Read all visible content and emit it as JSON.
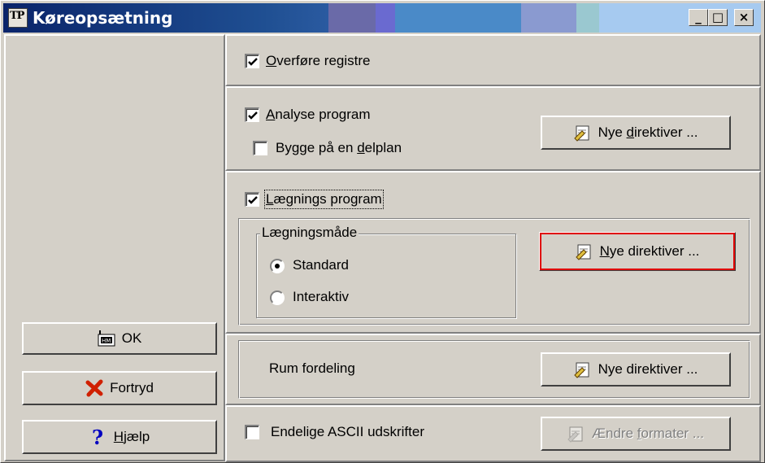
{
  "window": {
    "title": "Køreopsætning",
    "app_icon_text": "TP",
    "minimize": "_",
    "maximize": "□",
    "close": "×"
  },
  "colors": {
    "title_gradient": [
      "#0a246a",
      "#2a5aa0",
      "#6a6aa8",
      "#6a6ad0",
      "#4a8ac8",
      "#8a9ad0",
      "#9ac8d0",
      "#a6caf0"
    ],
    "focus_outline": "#e00000",
    "cancel_icon": "#d02000",
    "help_icon": "#0000c0"
  },
  "left": {
    "ok_label": "OK",
    "cancel_label": "Fortryd",
    "help_label": "Hjælp",
    "help_mnemonic": "H",
    "help_rest": "jælp"
  },
  "sections": {
    "transfer": {
      "label_mnemonic": "O",
      "label_rest": "verføre registre",
      "checked": true
    },
    "analyse": {
      "label_mnemonic": "A",
      "label_rest": "nalyse program",
      "checked": true,
      "subplan_pre": "Bygge på en ",
      "subplan_mnemonic": "d",
      "subplan_rest": "elplan",
      "subplan_checked": false,
      "button_pre": "Nye ",
      "button_mnemonic": "d",
      "button_rest": "irektiver ..."
    },
    "placement": {
      "label_mnemonic": "L",
      "label_rest": "ægnings program",
      "checked": true,
      "group_title": "Lægningsmåde",
      "radio_standard": "Standard",
      "radio_interactive": "Interaktiv",
      "selected": "Standard",
      "button_mnemonic": "N",
      "button_rest": "ye direktiver ..."
    },
    "room": {
      "label": "Rum fordeling",
      "button_label": "Nye direktiver ..."
    },
    "ascii": {
      "label": "Endelige ASCII udskrifter",
      "checked": false,
      "button_pre": "Ændre ",
      "button_mnemonic": "f",
      "button_rest": "ormater ..."
    }
  }
}
